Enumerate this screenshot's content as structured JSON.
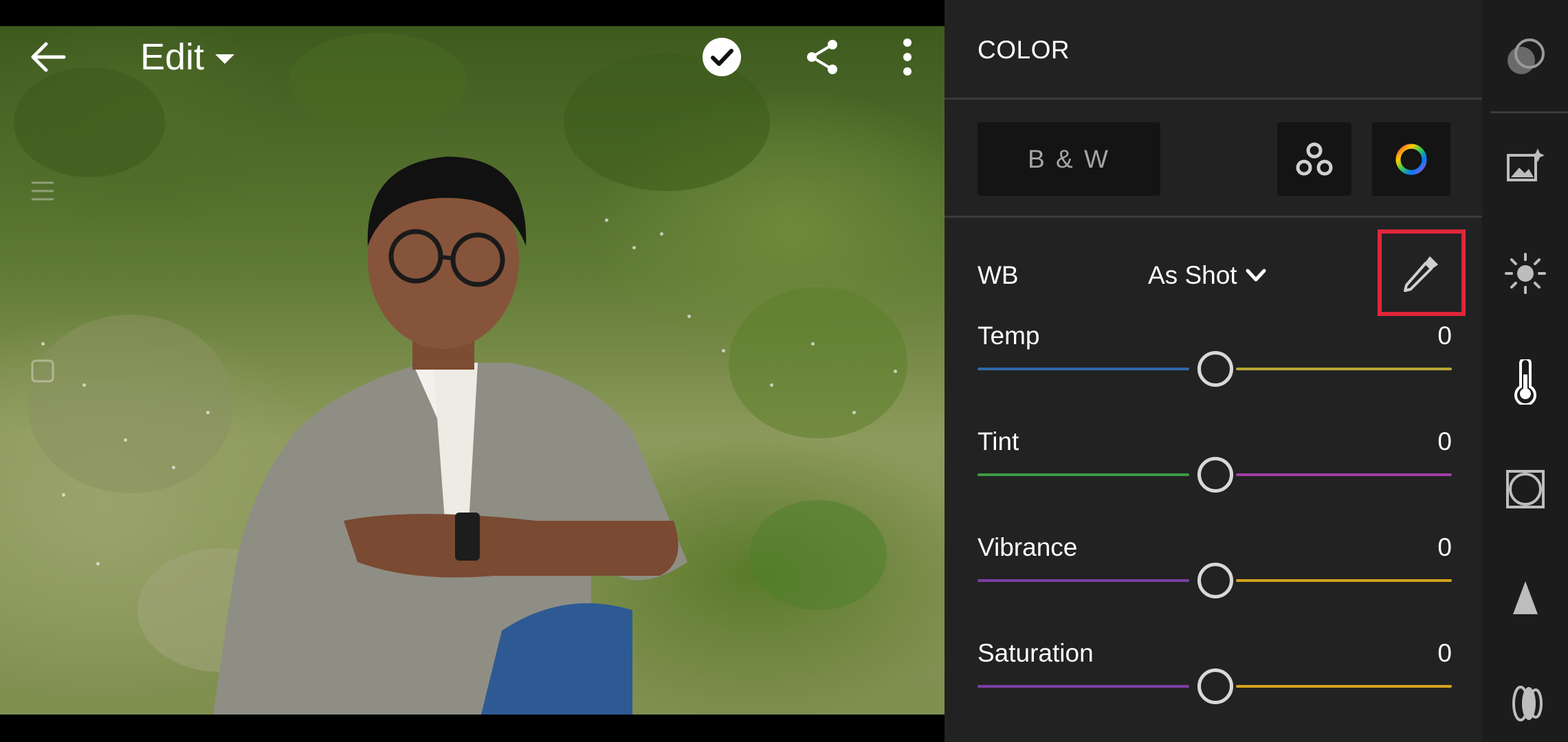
{
  "header": {
    "edit_label": "Edit",
    "back_icon": "back-arrow-icon",
    "done_icon": "checkmark-icon",
    "share_icon": "share-icon",
    "more_icon": "more-vertical-icon"
  },
  "panel": {
    "title": "COLOR",
    "bw_label": "B & W",
    "mix_icon": "color-mix-icon",
    "grading_icon": "color-wheel-icon",
    "wb": {
      "label": "WB",
      "value": "As Shot",
      "eyedropper_icon": "eyedropper-icon",
      "highlight_color": "#e0263a"
    },
    "sliders": [
      {
        "label": "Temp",
        "value": "0",
        "position": 0.5,
        "colors": [
          "#2f6aa8",
          "#b6a634"
        ]
      },
      {
        "label": "Tint",
        "value": "0",
        "position": 0.5,
        "colors": [
          "#3e9a45",
          "#a03fa8"
        ]
      },
      {
        "label": "Vibrance",
        "value": "0",
        "position": 0.5,
        "colors": [
          "#7a3fa6",
          "#d4a21e"
        ]
      },
      {
        "label": "Saturation",
        "value": "0",
        "position": 0.5,
        "colors": [
          "#7a3fa6",
          "#d4a21e"
        ]
      }
    ]
  },
  "rail": {
    "items": [
      {
        "name": "presets",
        "icon": "presets-icon"
      },
      {
        "name": "auto",
        "icon": "auto-enhance-icon"
      },
      {
        "name": "light",
        "icon": "light-sun-icon"
      },
      {
        "name": "color",
        "icon": "thermometer-icon",
        "active": true
      },
      {
        "name": "effects",
        "icon": "effects-icon"
      },
      {
        "name": "detail",
        "icon": "detail-triangle-icon"
      },
      {
        "name": "optics",
        "icon": "optics-lens-icon"
      }
    ]
  }
}
